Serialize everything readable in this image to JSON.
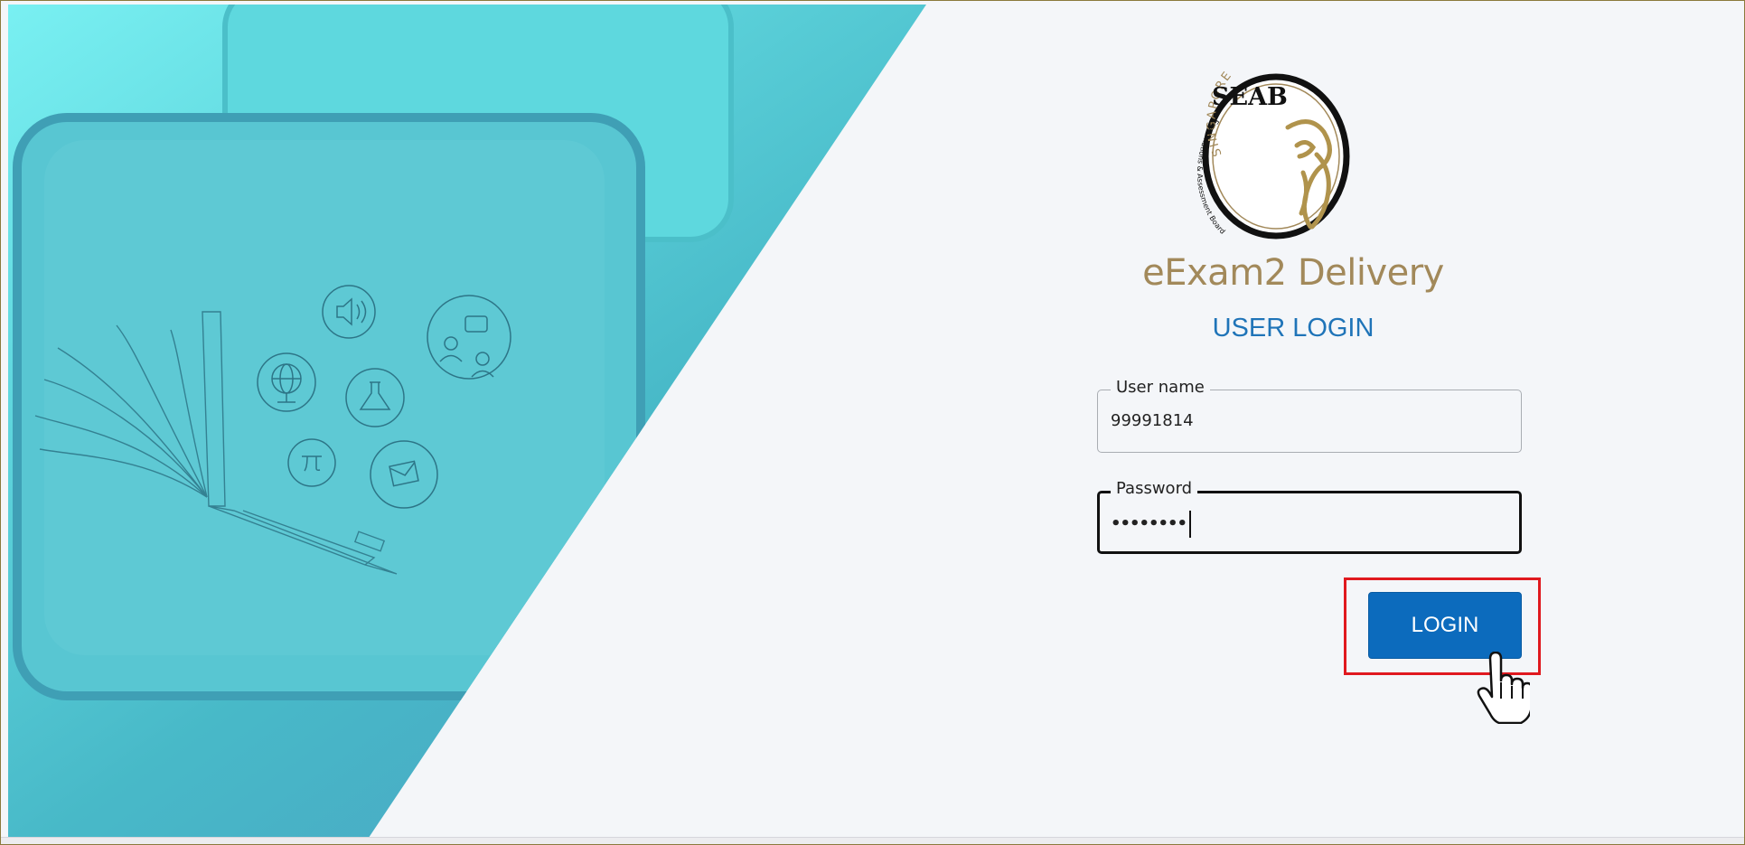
{
  "logo": {
    "arc_text": "SINGAPORE",
    "acronym": "SEAB",
    "ring_text": "Examinations & Assessment Board"
  },
  "app_title": "eExam2 Delivery",
  "login_heading": "USER LOGIN",
  "form": {
    "username": {
      "label": "User name",
      "value": "99991814"
    },
    "password": {
      "label": "Password",
      "masked_value": "••••••••"
    }
  },
  "buttons": {
    "login": "LOGIN"
  },
  "colors": {
    "brand_gold": "#a2895a",
    "heading_blue": "#1f74b8",
    "button_blue": "#0c6bbd",
    "highlight_red": "#e0191f"
  },
  "icons": [
    "speaker-icon",
    "people-chat-icon",
    "globe-icon",
    "flask-icon",
    "pi-icon",
    "envelope-icon",
    "open-book-laptop-icon",
    "hand-pointer-cursor-icon"
  ]
}
